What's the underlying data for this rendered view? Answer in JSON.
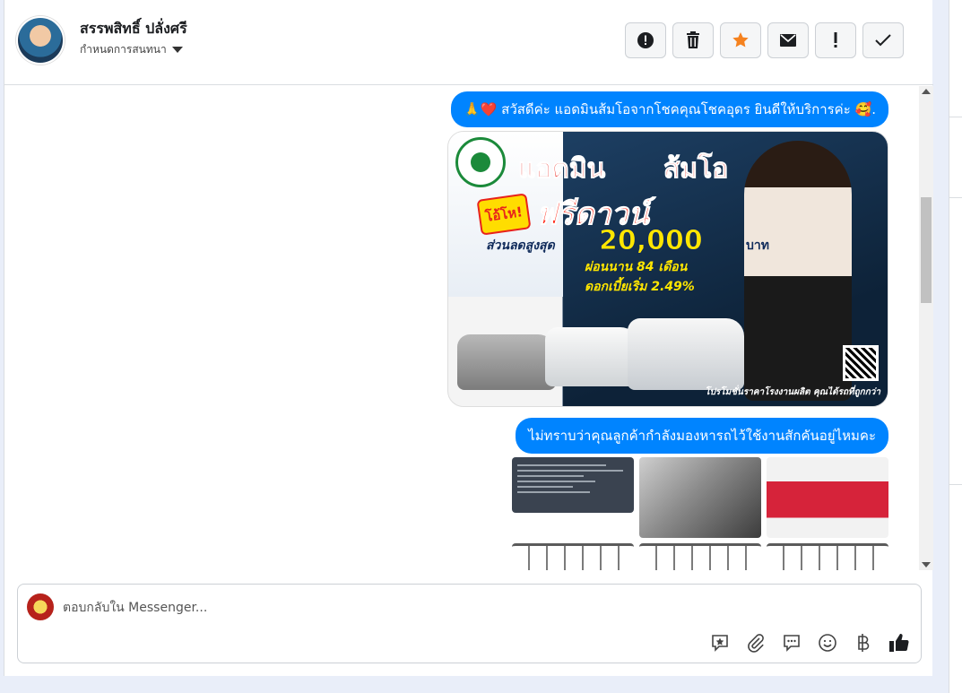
{
  "header": {
    "name": "สรรพสิทธิ์ ปลั่งศรี",
    "assign_label": "กำหนดการสนทนา"
  },
  "toolbar": {
    "icons": [
      "spam-icon",
      "trash-icon",
      "star-icon",
      "envelope-icon",
      "exclamation-icon",
      "checkmark-icon"
    ],
    "labels": [
      "!",
      "🗑",
      "★",
      "✉",
      "!",
      "✓"
    ]
  },
  "messages": {
    "greeting": "🙏❤️ สวัสดีค่ะ แอดมินส้มโอจากโชคคุณโชคอุดร ยินดีให้บริการค่ะ 🥰.",
    "question": "ไม่ทราบว่าคุณลูกค้ากำลังมองหารถไว้ใช้งานสักคันอยู่ไหมคะ"
  },
  "promo": {
    "admin_text": "แอดมิน",
    "name_text": "ส้มโอ",
    "free_down": "ฟรีดาวน์",
    "tag": "โอ้โห!",
    "discount_label": "ส่วนลดสูงสุด",
    "discount_value": "20,000",
    "currency": "บาท",
    "installment": "ผ่อนนาน 84 เดือน",
    "interest": "ดอกเบี้ยเริ่ม 2.49%",
    "footer": "โปรโมชั่นราคาโรงงานผลิต คุณได้รถที่ถูกกว่า"
  },
  "composer": {
    "placeholder": "ตอบกลับใน Messenger...",
    "icons": [
      "saved-reply-icon",
      "attachment-icon",
      "quick-reply-icon",
      "emoji-icon",
      "baht-icon",
      "like-icon"
    ]
  }
}
